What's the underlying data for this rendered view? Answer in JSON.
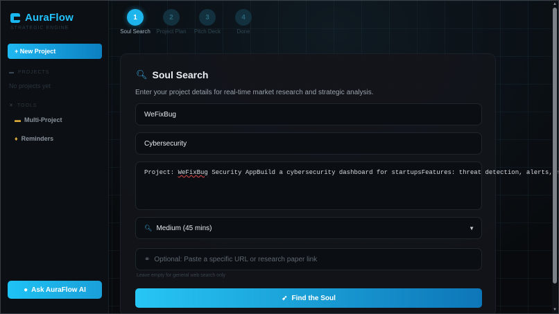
{
  "brand": {
    "title": "AuraFlow",
    "subtitle": "STRATEGIC ENGINE",
    "icon": "auraflow-logo-icon",
    "accent": "#1fb8f2"
  },
  "sidebar": {
    "new_project_label": "+ New Project",
    "projects_label": "PROJECTS",
    "projects_empty": "No projects yet",
    "tools_label": "TOOLS",
    "tools": [
      {
        "label": "Multi-Project",
        "icon": "folder-icon"
      },
      {
        "label": "Reminders",
        "icon": "bell-icon"
      }
    ],
    "ask_ai_label": "Ask AuraFlow AI"
  },
  "steps": [
    {
      "number": "1",
      "label": "Soul Search",
      "active": true
    },
    {
      "number": "2",
      "label": "Project Plan",
      "active": false
    },
    {
      "number": "3",
      "label": "Pitch Deck",
      "active": false
    },
    {
      "number": "4",
      "label": "Done",
      "active": false
    }
  ],
  "card": {
    "title": "Soul Search",
    "subtitle": "Enter your project details for real-time market research and strategic analysis.",
    "project_name": "WeFixBug",
    "industry": "Cybersecurity",
    "description_line1_prefix": "Project: ",
    "description_line1_word": "WeFixBug",
    "description_line1_suffix": " Security App",
    "description_line2": "Build a cybersecurity dashboard for startups",
    "description_line3": "Features: threat detection, alerts, reports",
    "depth_selected": "Medium (45 mins)",
    "url_placeholder": "Optional: Paste a specific URL or research paper link",
    "url_hint": "Leave empty for general web search only",
    "find_button_label": "Find the Soul"
  }
}
